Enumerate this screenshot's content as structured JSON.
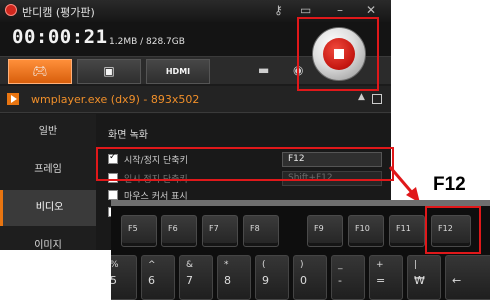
{
  "window": {
    "title": "반디캠 (평가판)",
    "titlebar_icons": [
      "key-icon",
      "folder-icon",
      "minimize-icon",
      "close-icon"
    ]
  },
  "status": {
    "timer": "00:00:21",
    "file_size": "1.2MB / 828.7GB"
  },
  "record_button": {
    "icon": "stop-icon",
    "color": "#d0281e"
  },
  "toolbar": {
    "tabs": [
      {
        "icon": "gamepad-icon",
        "active": true
      },
      {
        "icon": "screen-icon",
        "active": false
      },
      {
        "icon": "hdmi-icon",
        "label": "HDMI",
        "active": false
      }
    ],
    "tools": [
      "folder-icon",
      "camera-icon"
    ]
  },
  "target": {
    "name": "wmplayer.exe (dx9)",
    "size": " - 893x502",
    "icon": "play-icon",
    "accent": "#f08f2a"
  },
  "sidebar": {
    "items": [
      {
        "label": "일반",
        "active": false
      },
      {
        "label": "프레임",
        "active": false
      },
      {
        "label": "비디오",
        "active": true
      },
      {
        "label": "이미지",
        "active": false
      }
    ]
  },
  "content": {
    "section_title": "화면 녹화",
    "options": [
      {
        "label": "시작/정지 단축키",
        "checked": true,
        "enabled": true,
        "hotkey": "F12"
      },
      {
        "label": "일시 정지 단축키",
        "checked": false,
        "enabled": false,
        "hotkey": "Shift+F12"
      },
      {
        "label": "마우스 커서 표시",
        "checked": false,
        "enabled": true
      },
      {
        "label": "",
        "checked": false,
        "enabled": true
      }
    ]
  },
  "annotation": {
    "caption": "F12",
    "highlight_color": "#e0181a"
  },
  "keyboard": {
    "function_keys": [
      "F5",
      "F6",
      "F7",
      "F8",
      "F9",
      "F10",
      "F11",
      "F12"
    ],
    "number_keys": [
      {
        "top": "%",
        "bottom": "5"
      },
      {
        "top": "^",
        "bottom": "6"
      },
      {
        "top": "&",
        "bottom": "7"
      },
      {
        "top": "*",
        "bottom": "8"
      },
      {
        "top": "(",
        "bottom": "9"
      },
      {
        "top": ")",
        "bottom": "0"
      },
      {
        "top": "_",
        "bottom": "-"
      },
      {
        "top": "+",
        "bottom": "="
      },
      {
        "top": "|",
        "bottom": "₩"
      },
      {
        "top": "",
        "bottom": "←"
      }
    ]
  }
}
